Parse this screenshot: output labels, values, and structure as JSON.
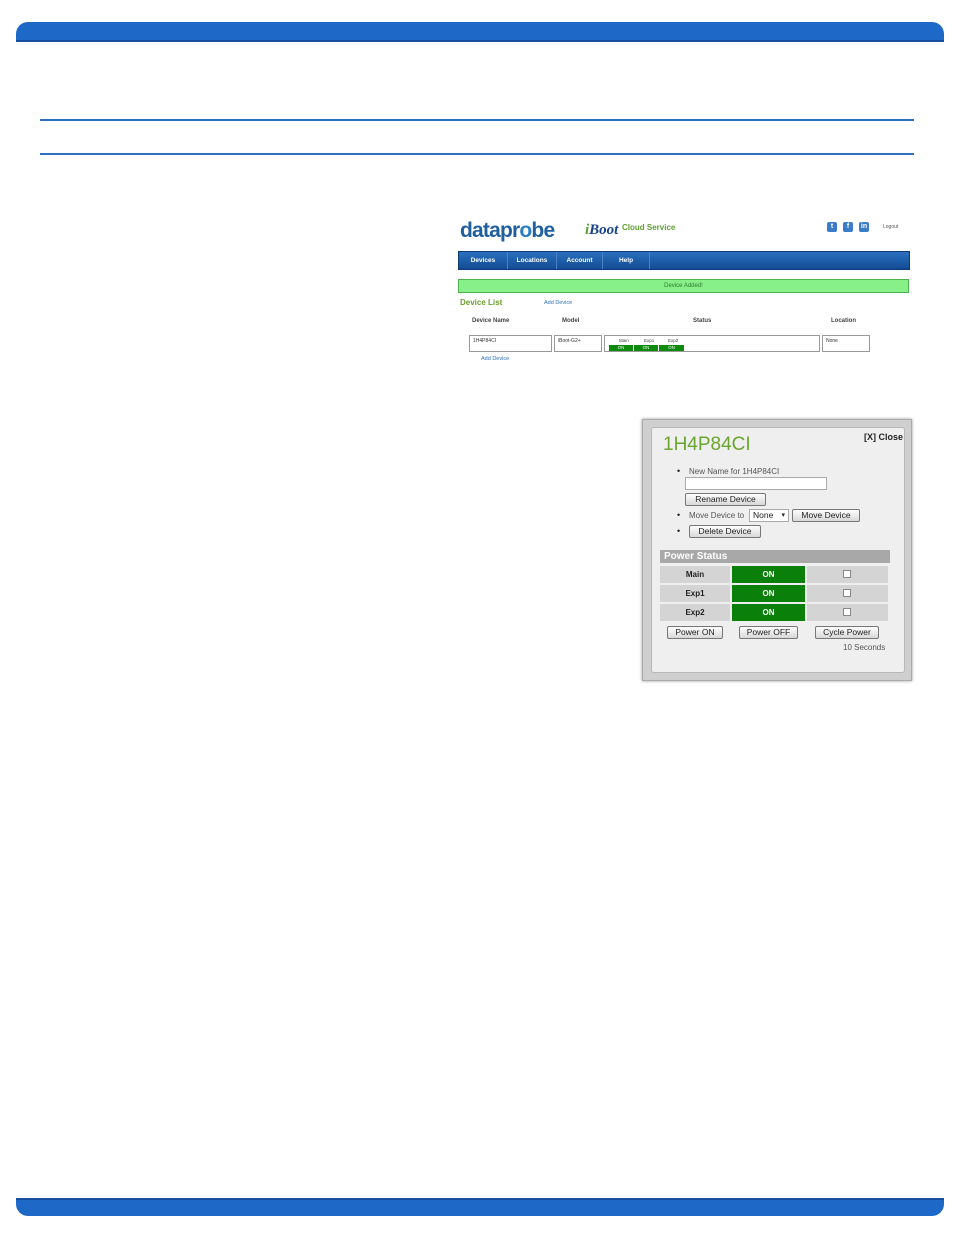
{
  "topbar": {
    "brand": {
      "data": "datapr",
      "o": "o",
      "be": "be"
    },
    "product": {
      "i": "i",
      "rest": "Boot"
    },
    "service": "Cloud Service",
    "social": [
      "t",
      "f",
      "in"
    ],
    "logout": "Logout"
  },
  "nav": [
    {
      "label": "Devices"
    },
    {
      "label": "Locations"
    },
    {
      "label": "Account"
    },
    {
      "label": "Help"
    }
  ],
  "banner": "Device Added!",
  "device_list": {
    "title": "Device List",
    "add_link": "Add Device",
    "add_link_bottom": "Add Device",
    "headers": {
      "name": "Device Name",
      "model": "Model",
      "status": "Status",
      "location": "Location"
    },
    "row": {
      "name": "1H4P84CI",
      "model": "iBoot-G2+",
      "outlets": [
        {
          "label": "Main",
          "state": "ON"
        },
        {
          "label": "Exp1",
          "state": "ON"
        },
        {
          "label": "Exp2",
          "state": "ON"
        }
      ],
      "location": "None"
    }
  },
  "dialog": {
    "title": "1H4P84CI",
    "close": "[X] Close",
    "rename_label": "New Name for 1H4P84CI",
    "rename_value": "",
    "rename_button": "Rename Device",
    "move_label": "Move Device to",
    "move_selected": "None",
    "move_button": "Move Device",
    "delete_button": "Delete Device",
    "power_status_title": "Power Status",
    "outlets": [
      {
        "label": "Main",
        "state": "ON"
      },
      {
        "label": "Exp1",
        "state": "ON"
      },
      {
        "label": "Exp2",
        "state": "ON"
      }
    ],
    "power_on": "Power ON",
    "power_off": "Power OFF",
    "cycle": "Cycle Power",
    "cycle_time": "10 Seconds"
  }
}
